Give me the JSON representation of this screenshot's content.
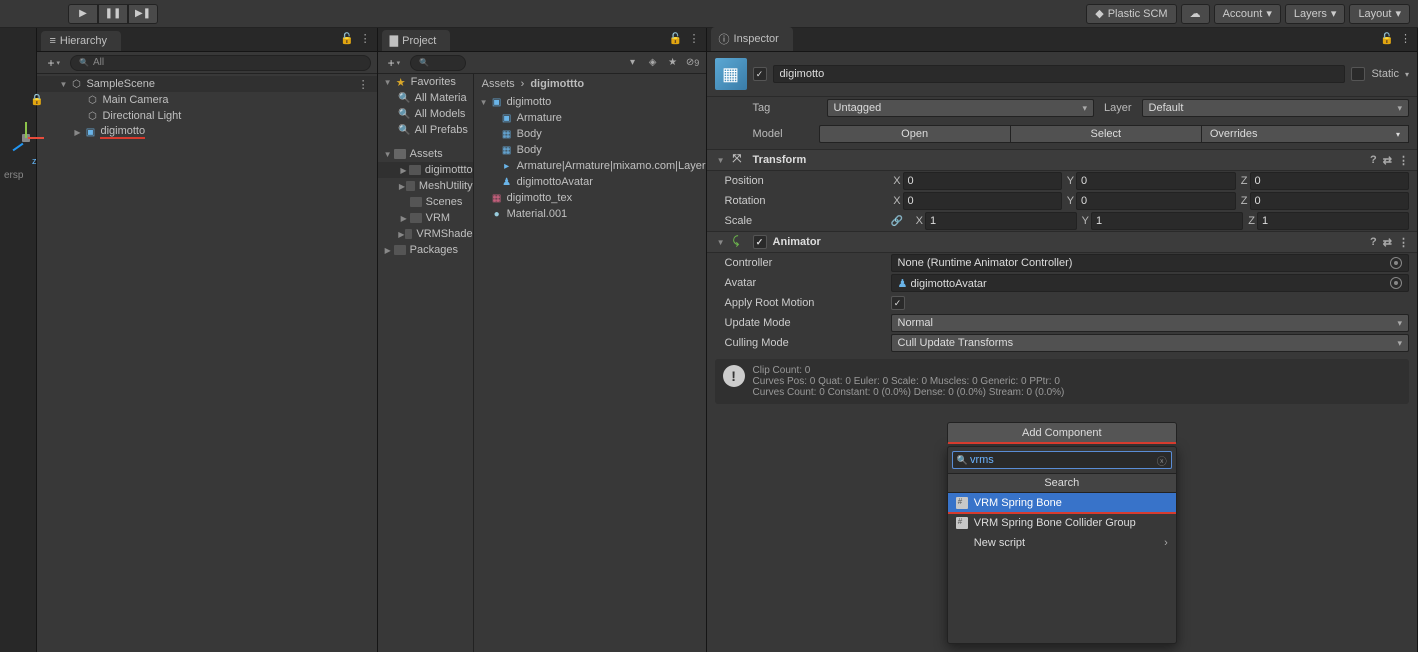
{
  "toolbar": {
    "plastic": "Plastic SCM",
    "account": "Account",
    "layers": "Layers",
    "layout": "Layout"
  },
  "hierarchy": {
    "title": "Hierarchy",
    "search_placeholder": "All",
    "scene": "SampleScene",
    "items": [
      "Main Camera",
      "Directional Light",
      "digimotto"
    ]
  },
  "scene_gizmo": {
    "persp": "ersp",
    "z": "z"
  },
  "project": {
    "title": "Project",
    "hidden_count": "9",
    "favorites": "Favorites",
    "fav_items": [
      "All Materia",
      "All Models",
      "All Prefabs"
    ],
    "assets": "Assets",
    "asset_folders": [
      "digimottto",
      "MeshUtility",
      "Scenes",
      "VRM",
      "VRMShade"
    ],
    "packages": "Packages",
    "breadcrumb_root": "Assets",
    "breadcrumb_current": "digimottto",
    "right_items": [
      {
        "icon": "prefab-icon",
        "label": "digimotto"
      },
      {
        "icon": "prefab-icon",
        "label": "Armature"
      },
      {
        "icon": "mesh-icon",
        "label": "Body"
      },
      {
        "icon": "mesh-icon",
        "label": "Body"
      },
      {
        "icon": "anim-icon",
        "label": "Armature|Armature|mixamo.com|Layer"
      },
      {
        "icon": "avatar-icon",
        "label": "digimottoAvatar"
      },
      {
        "icon": "tex-icon",
        "label": "digimotto_tex"
      },
      {
        "icon": "mat-icon",
        "label": "Material.001"
      }
    ]
  },
  "inspector": {
    "title": "Inspector",
    "name": "digimotto",
    "static": "Static",
    "tag_label": "Tag",
    "tag_value": "Untagged",
    "layer_label": "Layer",
    "layer_value": "Default",
    "model_label": "Model",
    "open": "Open",
    "select": "Select",
    "overrides": "Overrides",
    "transform": {
      "title": "Transform",
      "position": "Position",
      "rotation": "Rotation",
      "scale": "Scale",
      "px": "0",
      "py": "0",
      "pz": "0",
      "rx": "0",
      "ry": "0",
      "rz": "0",
      "sx": "1",
      "sy": "1",
      "sz": "1"
    },
    "animator": {
      "title": "Animator",
      "controller_label": "Controller",
      "controller_value": "None (Runtime Animator Controller)",
      "avatar_label": "Avatar",
      "avatar_value": "digimottoAvatar",
      "apply_root": "Apply Root Motion",
      "update_mode_label": "Update Mode",
      "update_mode_value": "Normal",
      "culling_label": "Culling Mode",
      "culling_value": "Cull Update Transforms",
      "info1": "Clip Count: 0",
      "info2": "Curves Pos: 0 Quat: 0 Euler: 0 Scale: 0 Muscles: 0 Generic: 0 PPtr: 0",
      "info3": "Curves Count: 0 Constant: 0 (0.0%) Dense: 0 (0.0%) Stream: 0 (0.0%)"
    },
    "add_component": "Add Component",
    "popup": {
      "search_value": "vrms",
      "header": "Search",
      "item1": "VRM Spring Bone",
      "item2": "VRM Spring Bone Collider Group",
      "item3": "New script"
    }
  }
}
